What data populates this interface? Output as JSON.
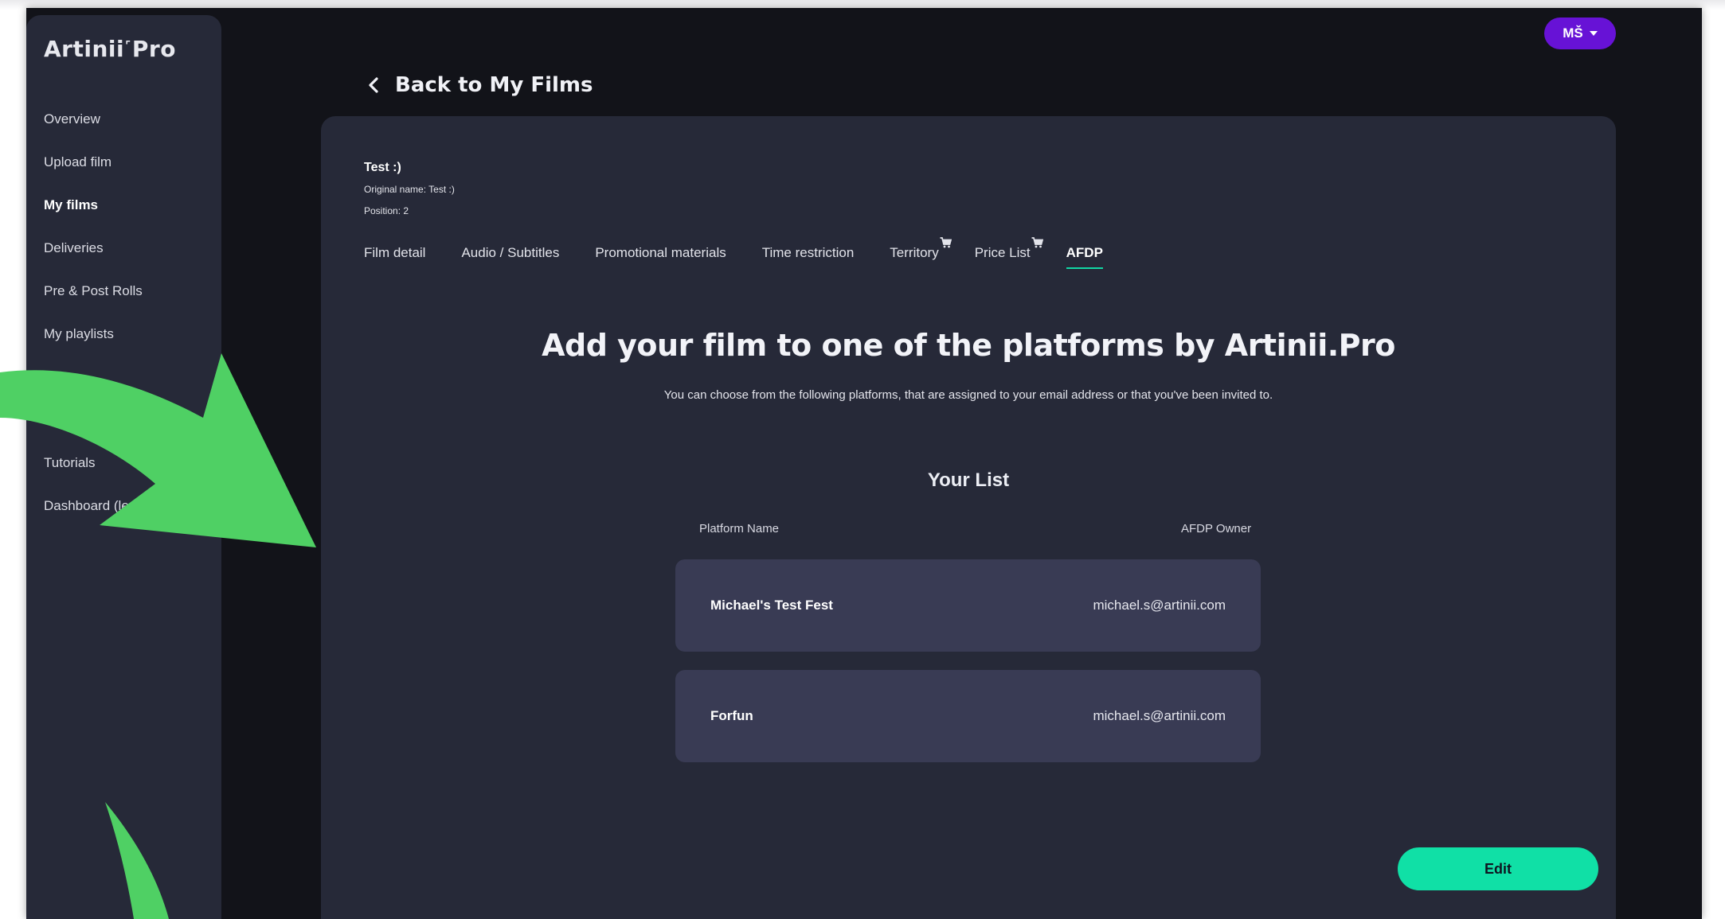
{
  "app": {
    "logo": "Artinii˹Pro",
    "user_initials": "MŠ"
  },
  "sidebar": {
    "items": [
      {
        "label": "Overview",
        "active": false
      },
      {
        "label": "Upload film",
        "active": false
      },
      {
        "label": "My films",
        "active": true
      },
      {
        "label": "Deliveries",
        "active": false
      },
      {
        "label": "Pre & Post Rolls",
        "active": false
      },
      {
        "label": "My playlists",
        "active": false
      },
      {
        "label": "",
        "active": false
      },
      {
        "label": "",
        "active": false
      },
      {
        "label": "Tutorials",
        "active": false
      },
      {
        "label": "Dashboard (le",
        "active": false
      }
    ]
  },
  "header": {
    "back_label": "Back to My Films"
  },
  "film": {
    "title": "Test :)",
    "original_name": "Original name: Test :)",
    "position": "Position: 2"
  },
  "tabs": [
    {
      "label": "Film detail",
      "active": false,
      "cart": false
    },
    {
      "label": "Audio / Subtitles",
      "active": false,
      "cart": false
    },
    {
      "label": "Promotional materials",
      "active": false,
      "cart": false
    },
    {
      "label": "Time restriction",
      "active": false,
      "cart": false
    },
    {
      "label": "Territory",
      "active": false,
      "cart": true
    },
    {
      "label": "Price List",
      "active": false,
      "cart": true
    },
    {
      "label": "AFDP",
      "active": true,
      "cart": false
    }
  ],
  "main": {
    "headline": "Add your film to one of the platforms by Artinii.Pro",
    "subline": "You can choose from the following platforms, that are assigned to your email address or that you've been invited to.",
    "list_title": "Your List",
    "columns": {
      "platform": "Platform Name",
      "owner": "AFDP Owner"
    },
    "rows": [
      {
        "platform": "Michael's Test Fest",
        "owner": "michael.s@artinii.com"
      },
      {
        "platform": "Forfun",
        "owner": "michael.s@artinii.com"
      }
    ],
    "edit_label": "Edit"
  },
  "colors": {
    "background": "#121319",
    "panel": "#262938",
    "row": "#393b54",
    "accent": "#10e0a6",
    "avatar": "#6712d6",
    "arrow": "#4fd064"
  },
  "icons": [
    "chevron-left-icon",
    "cart-icon",
    "caret-down-icon"
  ]
}
